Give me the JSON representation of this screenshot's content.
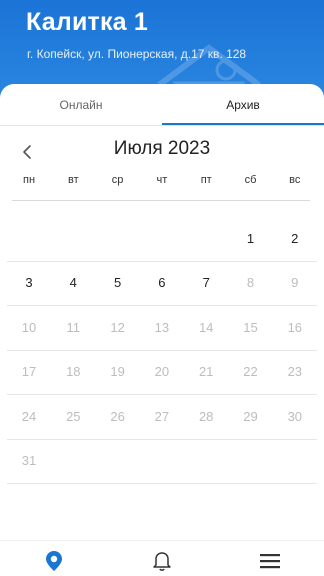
{
  "header": {
    "title": "Калитка 1",
    "address": "г. Копейск, ул. Пионерская, д.17 кв. 128"
  },
  "tabs": [
    {
      "label": "Онлайн",
      "active": false
    },
    {
      "label": "Архив",
      "active": true
    }
  ],
  "calendar": {
    "month_label": "Июля 2023",
    "weekdays": [
      "пн",
      "вт",
      "ср",
      "чт",
      "пт",
      "сб",
      "вс"
    ],
    "weeks": [
      [
        "",
        "",
        "",
        "",
        "",
        "1",
        "2"
      ],
      [
        "3",
        "4",
        "5",
        "6",
        "7",
        "8",
        "9"
      ],
      [
        "10",
        "11",
        "12",
        "13",
        "14",
        "15",
        "16"
      ],
      [
        "17",
        "18",
        "19",
        "20",
        "21",
        "22",
        "23"
      ],
      [
        "24",
        "25",
        "26",
        "27",
        "28",
        "29",
        "30"
      ],
      [
        "31",
        "",
        "",
        "",
        "",
        "",
        ""
      ]
    ],
    "enabled_days": [
      "1",
      "2",
      "3",
      "4",
      "5",
      "6",
      "7"
    ]
  },
  "icons": {
    "back": "chevron-left-icon",
    "nav_home": "location-pin-icon",
    "nav_notifications": "bell-icon",
    "nav_menu": "hamburger-menu-icon"
  },
  "colors": {
    "accent": "#1976d2",
    "disabled_text": "#bdbdbd"
  }
}
